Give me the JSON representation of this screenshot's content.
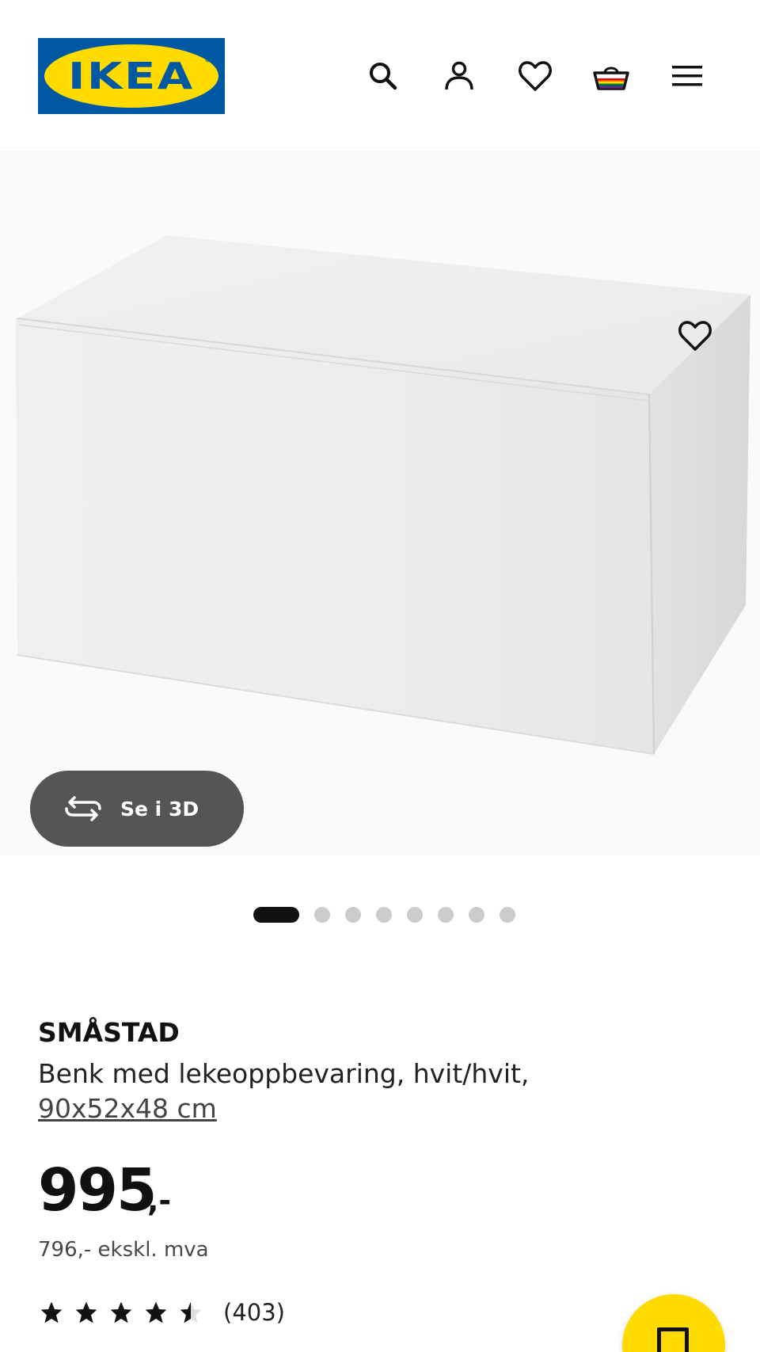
{
  "header": {
    "logo_text": "IKEA",
    "logo_reg": "®",
    "icons": [
      "search-icon",
      "account-icon",
      "heart-icon",
      "cart-icon",
      "menu-icon"
    ]
  },
  "colors": {
    "brand_blue": "#0058a3",
    "brand_yellow": "#ffdb00",
    "dark_button": "#555555",
    "text": "#111111"
  },
  "gallery": {
    "view3d_label": "Se i 3D",
    "image_count": 8,
    "active_index": 0
  },
  "product": {
    "name": "SMÅSTAD",
    "description": "Benk med lekeoppbevaring, hvit/hvit,",
    "dimensions": "90x52x48 cm",
    "price": "995",
    "price_suffix": ",-",
    "price_ex_vat": "796,- ekskl. mva",
    "rating": 4.5,
    "rating_count": "(403)"
  }
}
